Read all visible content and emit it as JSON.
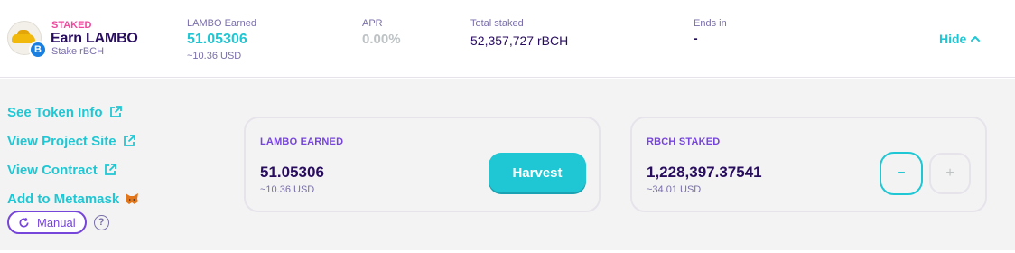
{
  "pool": {
    "status": "STAKED",
    "title": "Earn LAMBO",
    "subtitle": "Stake rBCH",
    "logo_badge_icon": "bitcoin-cash-icon",
    "logo_badge_glyph": "B"
  },
  "stats": {
    "earned_label": "LAMBO Earned",
    "earned_value": "51.05306",
    "earned_usd": "~10.36 USD",
    "apr_label": "APR",
    "apr_value": "0.00%",
    "total_label": "Total staked",
    "total_value": "52,357,727 rBCH",
    "ends_label": "Ends in",
    "ends_value": "-"
  },
  "toggle": {
    "label": "Hide",
    "icon": "chevron-up-icon"
  },
  "links": [
    {
      "label": "See Token Info",
      "icon": "open-new-icon"
    },
    {
      "label": "View Project Site",
      "icon": "open-new-icon"
    },
    {
      "label": "View Contract",
      "icon": "open-new-icon"
    },
    {
      "label": "Add to Metamask",
      "icon": "metamask-fox-icon"
    }
  ],
  "manual": {
    "label": "Manual",
    "help": "?"
  },
  "earned_card": {
    "heading": "LAMBO EARNED",
    "value": "51.05306",
    "usd": "~10.36 USD",
    "button": "Harvest"
  },
  "staked_card": {
    "heading": "RBCH STAKED",
    "value": "1,228,397.37541",
    "usd": "~34.01 USD",
    "minus": "−",
    "plus": "+"
  },
  "colors": {
    "accent": "#1fc7d4",
    "staked_pink": "#ed4b9e",
    "text_primary": "#280d5f",
    "text_secondary": "#7a6eaa",
    "heading_purple": "#7645d9",
    "panel_bg": "#f3f3f3"
  }
}
